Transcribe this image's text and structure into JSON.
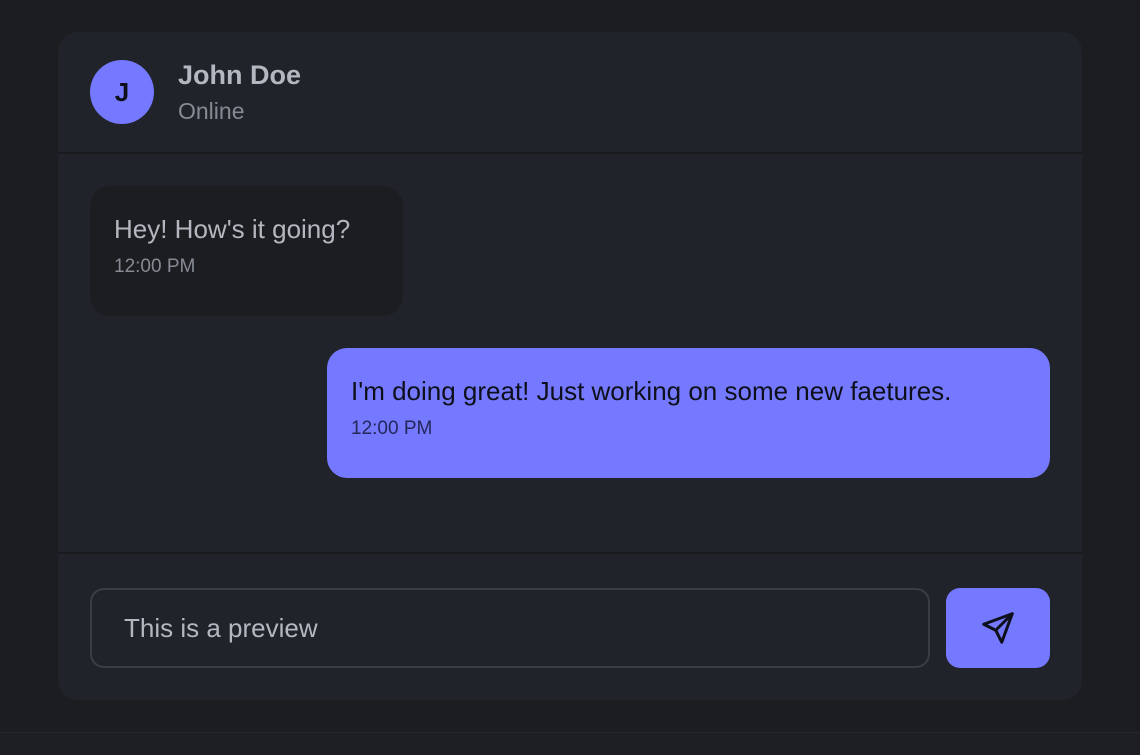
{
  "header": {
    "avatar_initial": "J",
    "name": "John Doe",
    "status": "Online"
  },
  "messages": [
    {
      "direction": "incoming",
      "text": "Hey! How's it going?",
      "time": "12:00 PM"
    },
    {
      "direction": "outgoing",
      "text": "I'm doing great! Just working on some new faetures.",
      "time": "12:00 PM"
    }
  ],
  "composer": {
    "input_value": "This is a preview",
    "send_icon": "send-icon"
  },
  "colors": {
    "accent": "#7479ff",
    "page_background": "#1b1d21",
    "card_background": "#20232a",
    "incoming_bubble": "#1b1d21"
  }
}
